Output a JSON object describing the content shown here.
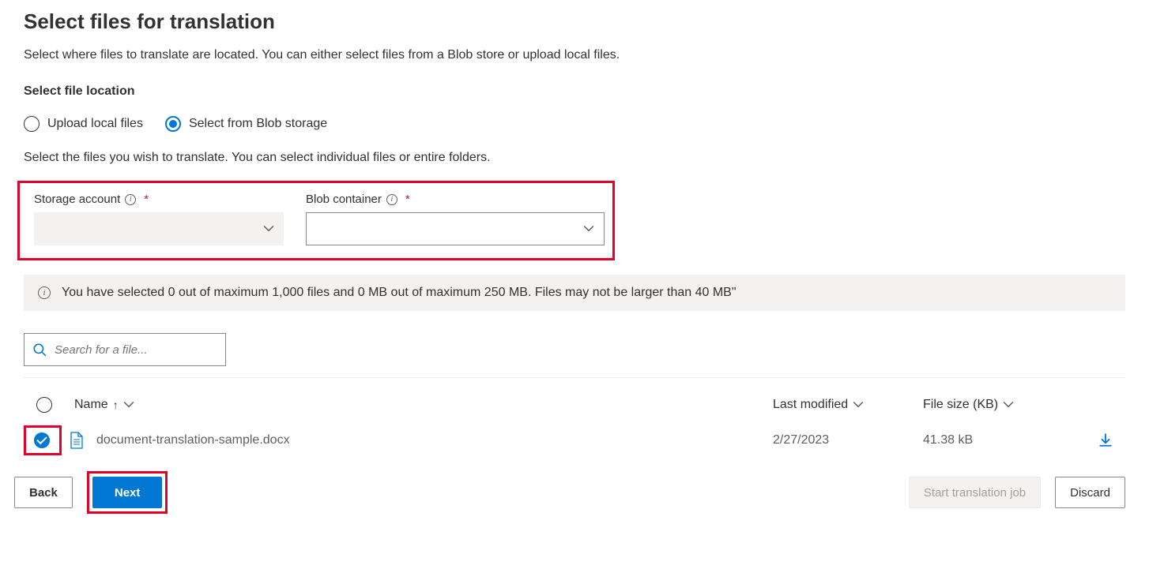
{
  "page": {
    "title": "Select files for translation",
    "subtitle": "Select where files to translate are located. You can either select files from a Blob store or upload local files."
  },
  "location": {
    "label": "Select file location",
    "option_upload": "Upload local files",
    "option_blob": "Select from Blob storage",
    "helper": "Select the files you wish to translate. You can select individual files or entire folders."
  },
  "fields": {
    "storage_label": "Storage account",
    "blob_label": "Blob container"
  },
  "info_bar": "You have selected 0 out of maximum 1,000 files and 0 MB out of maximum 250 MB. Files may not be larger than 40 MB\"",
  "search": {
    "placeholder": "Search for a file..."
  },
  "table": {
    "col_name": "Name",
    "col_modified": "Last modified",
    "col_size": "File size (KB)",
    "rows": [
      {
        "name": "document-translation-sample.docx",
        "modified": "2/27/2023",
        "size": "41.38 kB",
        "checked": true
      }
    ]
  },
  "footer": {
    "back": "Back",
    "next": "Next",
    "start": "Start translation job",
    "discard": "Discard"
  }
}
